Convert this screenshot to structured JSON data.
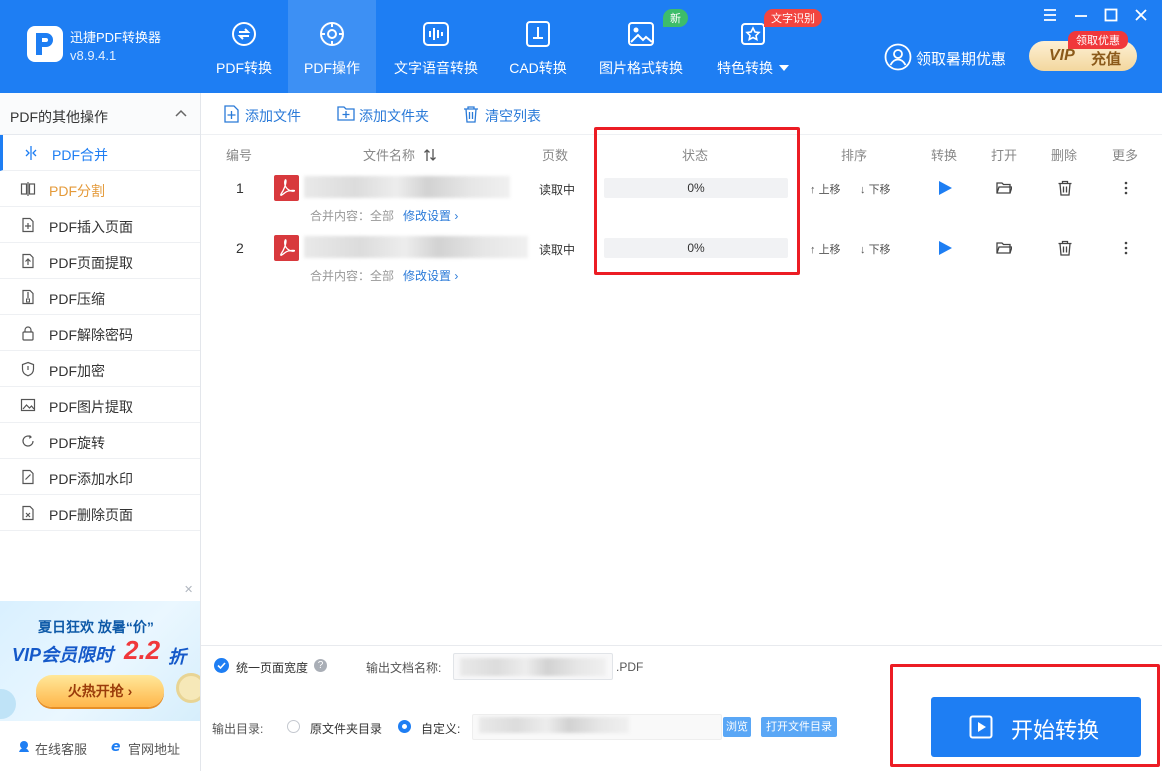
{
  "app": {
    "name": "迅捷PDF转换器",
    "version": "v8.9.4.1"
  },
  "nav": {
    "tabs": [
      {
        "label": "PDF转换",
        "icon": "pdf-convert-icon"
      },
      {
        "label": "PDF操作",
        "icon": "pdf-operate-icon",
        "active": true
      },
      {
        "label": "文字语音转换",
        "icon": "voice-icon"
      },
      {
        "label": "CAD转换",
        "icon": "cad-icon"
      },
      {
        "label": "图片格式转换",
        "icon": "image-icon",
        "badge": "新"
      },
      {
        "label": "特色转换",
        "icon": "special-icon",
        "badge": "文字识别"
      }
    ],
    "promo": "领取暑期优惠",
    "vip": {
      "label_vip": "VIP",
      "label_recharge": "充值",
      "tag": "领取优惠"
    }
  },
  "sidebar": {
    "header": "PDF的其他操作",
    "items": [
      {
        "label": "PDF合并",
        "icon": "merge-icon"
      },
      {
        "label": "PDF分割",
        "icon": "split-icon"
      },
      {
        "label": "PDF插入页面",
        "icon": "insert-page-icon"
      },
      {
        "label": "PDF页面提取",
        "icon": "extract-page-icon"
      },
      {
        "label": "PDF压缩",
        "icon": "compress-icon"
      },
      {
        "label": "PDF解除密码",
        "icon": "unlock-icon"
      },
      {
        "label": "PDF加密",
        "icon": "shield-icon"
      },
      {
        "label": "PDF图片提取",
        "icon": "image-extract-icon"
      },
      {
        "label": "PDF旋转",
        "icon": "rotate-icon"
      },
      {
        "label": "PDF添加水印",
        "icon": "watermark-icon"
      },
      {
        "label": "PDF删除页面",
        "icon": "delete-page-icon"
      }
    ],
    "banner": {
      "line1": "夏日狂欢 放暑“价”",
      "line2": "VIP会员限时",
      "price": "2.2",
      "unit": "折",
      "button": "火热开抢 ›"
    },
    "footer": {
      "service": "在线客服",
      "website": "官网地址"
    }
  },
  "toolbar": {
    "add_file": "添加文件",
    "add_folder": "添加文件夹",
    "clear": "清空列表"
  },
  "table": {
    "headers": {
      "no": "编号",
      "name": "文件名称",
      "pages": "页数",
      "status": "状态",
      "order": "排序",
      "convert": "转换",
      "open": "打开",
      "delete": "删除",
      "more": "更多"
    },
    "rows": [
      {
        "no": "1",
        "pages": "读取中",
        "progress": "0%",
        "merge_label": "合并内容：全部",
        "modify": "修改设置 ›",
        "up": "上移",
        "down": "下移"
      },
      {
        "no": "2",
        "pages": "读取中",
        "progress": "0%",
        "merge_label": "合并内容：全部",
        "modify": "修改设置 ›",
        "up": "上移",
        "down": "下移"
      }
    ]
  },
  "bottom": {
    "unify_width": "统一页面宽度",
    "output_name_label": "输出文档名称:",
    "output_ext": ".PDF",
    "output_dir_label": "输出目录:",
    "option_original": "原文件夹目录",
    "option_custom": "自定义:",
    "browse": "浏览",
    "open_dir": "打开文件目录",
    "start": "开始转换"
  }
}
